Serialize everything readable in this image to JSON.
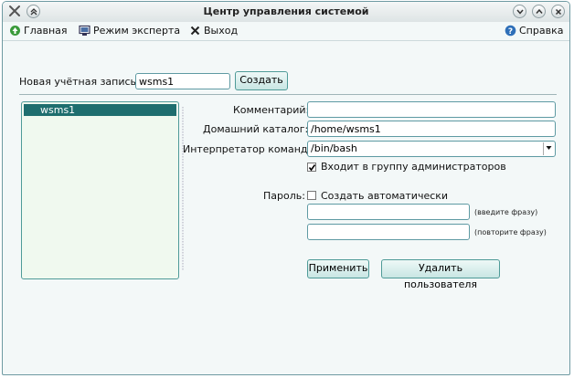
{
  "window": {
    "title": "Центр управления системой"
  },
  "menu": {
    "home": "Главная",
    "expert": "Режим эксперта",
    "exit": "Выход",
    "help": "Справка"
  },
  "new_account": {
    "label": "Новая учётная запись:",
    "value": "wsms1",
    "create": "Создать"
  },
  "users": [
    "wsms1"
  ],
  "form": {
    "comment_label": "Комментарий:",
    "comment_value": "",
    "home_label": "Домашний каталог:",
    "home_value": "/home/wsms1",
    "shell_label": "Интерпретатор команд:",
    "shell_value": "/bin/bash",
    "admin_group": "Входит в группу администраторов",
    "admin_checked": true,
    "password_label": "Пароль:",
    "auto_create": "Создать автоматически",
    "auto_checked": false,
    "hint_enter": "(введите фразу)",
    "hint_repeat": "(повторите фразу)",
    "apply": "Применить",
    "delete": "Удалить пользователя"
  },
  "colors": {
    "accent": "#1e6e6e",
    "border": "#4f9b98",
    "background": "#f3f8f8"
  }
}
